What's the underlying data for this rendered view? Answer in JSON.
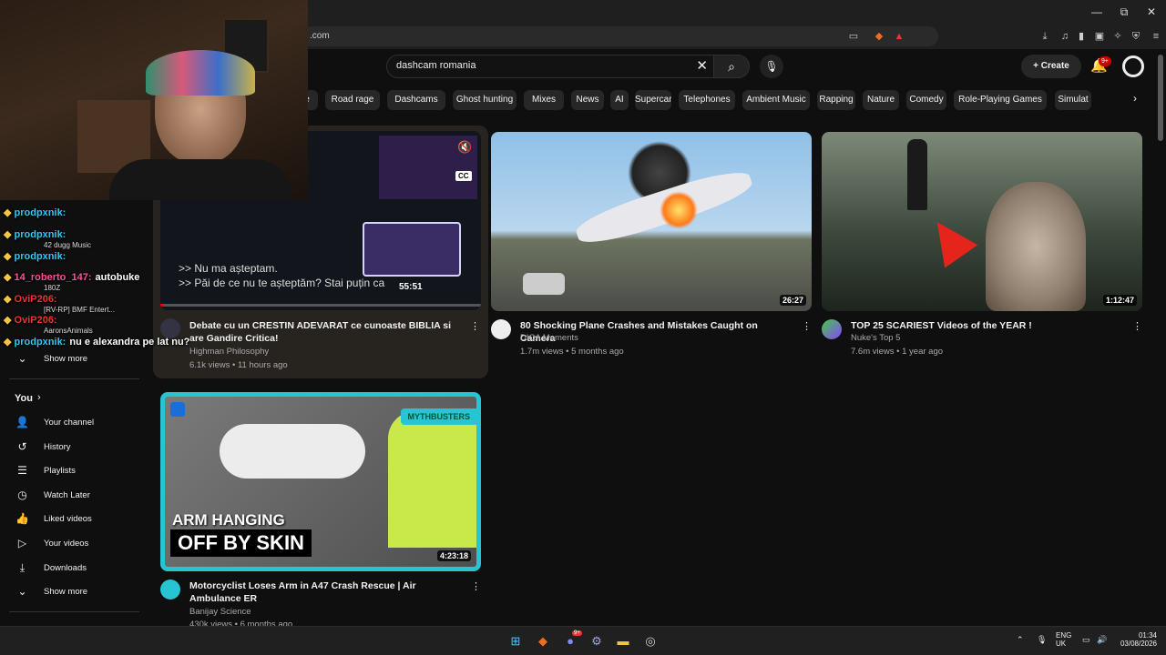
{
  "browser": {
    "url": ".com",
    "window_min": "—",
    "window_restore": "⧉",
    "window_close": "✕"
  },
  "header": {
    "search_value": "dashcam romania",
    "create_label": "Create",
    "notifications_badge": "9+"
  },
  "chips": [
    "e",
    "Road rage",
    "Dashcams",
    "Ghost hunting",
    "Mixes",
    "News",
    "AI",
    "Supercar",
    "Telephones",
    "Ambient Music",
    "Rapping",
    "Nature",
    "Comedy",
    "Role-Playing Games",
    "Simulat"
  ],
  "videos": [
    {
      "title": "Debate cu un CRESTIN ADEVARAT ce cunoaste BIBLIA si are Gandire Critica!",
      "channel": "Highman Philosophy",
      "meta": "6.1k views • 11 hours ago",
      "duration": "55:51",
      "subtitle1": ">> Nu ma așteptam.",
      "subtitle2": ">> Păi de ce nu te așteptăm? Stai puțin ca",
      "cc": "CC"
    },
    {
      "title": "80 Shocking Plane Crashes and Mistakes Caught on Camera",
      "channel": "DICA Moments",
      "meta": "1.7m views • 5 months ago",
      "duration": "26:27"
    },
    {
      "title": "TOP 25 SCARIEST Videos of the YEAR !",
      "channel": "Nuke's Top 5",
      "meta": "7.6m views • 1 year ago",
      "duration": "1:12:47"
    },
    {
      "title": "Motorcyclist Loses Arm in A47 Crash Rescue | Air Ambulance ER",
      "channel": "Banijay Science",
      "meta": "430k views • 6 months ago",
      "duration": "4:23:18",
      "badge": "MYTHBUSTERS",
      "overlay1": "ARM HANGING",
      "overlay2": "OFF BY SKIN"
    }
  ],
  "sidebar": {
    "show_more_top": "Show more",
    "you_label": "You",
    "items": [
      "Your channel",
      "History",
      "Playlists",
      "Watch Later",
      "Liked videos",
      "Your videos",
      "Downloads",
      "Show more"
    ]
  },
  "chat": [
    {
      "user": "prodpxnik:",
      "msg": "",
      "color": "#34c6f4"
    },
    {
      "user": "prodpxnik:",
      "msg": "",
      "color": "#34c6f4",
      "sub": "42 dugg Music"
    },
    {
      "user": "prodpxnik:",
      "msg": "",
      "color": "#34c6f4"
    },
    {
      "user": "14_roberto_147:",
      "msg": "autobuke",
      "color": "#ff4f9a",
      "sub": "180Z"
    },
    {
      "user": "OviP206:",
      "msg": "",
      "color": "#e3342f",
      "sub": "[RV-RP] BMF Entert..."
    },
    {
      "user": "OviP206:",
      "msg": "",
      "color": "#e3342f",
      "sub": "AaronsAnimals"
    },
    {
      "user": "prodpxnik:",
      "msg": "nu e alexandra pe lat nu?",
      "color": "#34c6f4"
    }
  ],
  "taskbar": {
    "lang1": "ENG",
    "lang2": "UK",
    "time": "01:34",
    "date": "03/08/2026",
    "discord_badge": "9+"
  }
}
